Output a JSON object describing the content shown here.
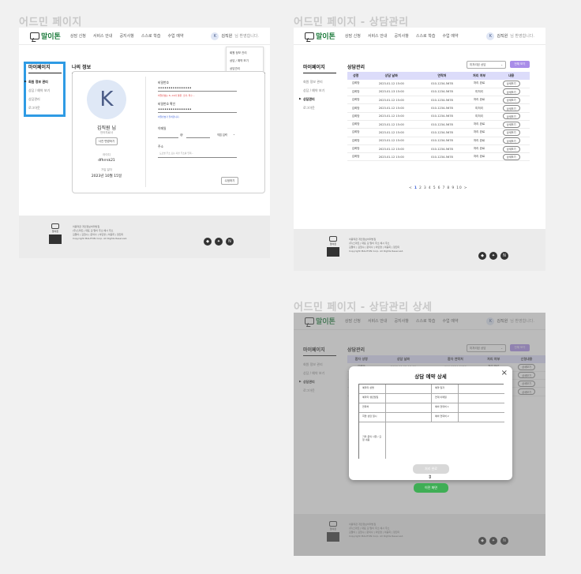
{
  "sections": {
    "s1": "어드민 페이지",
    "s2": "어드민 페이지 - 상담관리",
    "s3": "어드민 페이지 - 상담관리 상세"
  },
  "nav": {
    "brand": "말이톤",
    "menu": [
      "상담 신청",
      "서비스 안내",
      "공지사항",
      "스스로 학습",
      "수업 예약"
    ],
    "user_initial": "K",
    "user_name": "김직원",
    "user_suffix": "님 환영합니다."
  },
  "dropdown": [
    "회원 정보 관리",
    "상담 / 예약 보기",
    "상담관리",
    "로그아웃"
  ],
  "sidebar1": {
    "title": "마이페이지",
    "items": [
      "회원 정보 관리",
      "상담 / 예약 보기",
      "상담관리",
      "로그아웃"
    ]
  },
  "sidebar2": {
    "title": "마이페이지",
    "items": [
      "회원 정보 관리",
      "상담 / 예약 보기",
      "상담관리",
      "로그아웃"
    ]
  },
  "profile": {
    "title": "나의 정보",
    "initial": "K",
    "name": "김직원 님",
    "role": "언어치료사",
    "photo_btn": "사진 변경하기",
    "id_label": "아이디",
    "id_value": "dfhrrsk21",
    "join_label": "가입 일자",
    "join_value": "2023년 10월 15일",
    "pw_label": "비밀번호",
    "pw_value": "••••••••••••••••",
    "pw_hint": "비밀번호는 8~16자 영문, 숫자, 특수...",
    "pw2_label": "비밀번호 확인",
    "pw2_value": "••••••••••••••••",
    "pw2_hint": "비밀번호가 일치합니다.",
    "email_label": "이메일",
    "email_value": "",
    "email_at": "@",
    "email_select": "직접 입력",
    "addr_label": "주소",
    "addr_hint": "도로명 주소 또는 지번 주소를 입력...",
    "save_btn": "수정하기"
  },
  "consult": {
    "title": "상담관리",
    "filter": "미처리된 상담",
    "search_btn": "전체 보기",
    "headers": [
      "성명",
      "상담 날짜",
      "연락처",
      "처리 여부",
      "내용"
    ],
    "rows": [
      {
        "name": "김희망",
        "date": "2023.01.12 15:00",
        "phone": "010-1234-5678",
        "status": "처리 완료",
        "state": "done",
        "action": "상세보기"
      },
      {
        "name": "김희망",
        "date": "2023.01.13 15:00",
        "phone": "010-1234-5678",
        "status": "미처리",
        "state": "wait",
        "action": "상세보기"
      },
      {
        "name": "김희망",
        "date": "2023.01.12 15:00",
        "phone": "010-1234-5678",
        "status": "처리 완료",
        "state": "done",
        "action": "상세보기"
      },
      {
        "name": "김희망",
        "date": "2023.01.12 15:00",
        "phone": "010-1234-5678",
        "status": "미처리",
        "state": "wait",
        "action": "상세보기"
      },
      {
        "name": "김희망",
        "date": "2023.01.12 15:00",
        "phone": "010-1234-5678",
        "status": "미처리",
        "state": "wait",
        "action": "상세보기"
      },
      {
        "name": "김희망",
        "date": "2023.01.12 15:00",
        "phone": "010-1234-5678",
        "status": "처리 완료",
        "state": "done",
        "action": "상세보기"
      },
      {
        "name": "김희망",
        "date": "2023.01.12 15:00",
        "phone": "010-1234-5678",
        "status": "처리 완료",
        "state": "done",
        "action": "상세보기"
      },
      {
        "name": "김희망",
        "date": "2023.01.12 15:00",
        "phone": "010-1234-5678",
        "status": "처리 완료",
        "state": "done",
        "action": "상세보기"
      },
      {
        "name": "김희망",
        "date": "2023.01.12 15:00",
        "phone": "010-1234-5678",
        "status": "처리 완료",
        "state": "done",
        "action": "상세보기"
      },
      {
        "name": "김희망",
        "date": "2023.01.12 15:00",
        "phone": "010-1234-5678",
        "status": "처리 완료",
        "state": "done",
        "action": "상세보기"
      }
    ],
    "pager_prev": "<",
    "pages": [
      "1",
      "2",
      "3",
      "4",
      "5",
      "6",
      "7",
      "8",
      "9",
      "10"
    ],
    "pager_next": ">"
  },
  "consult3": {
    "headers": [
      "환자 성명",
      "상담 날짜",
      "환자 연락처",
      "처리 여부",
      "신청내용"
    ]
  },
  "modal": {
    "title": "상담 예약 상세",
    "close": "×",
    "labels_left": [
      "예약자 성명",
      "예약자 생년월일",
      "연락처",
      "희망 상담 일시"
    ],
    "labels_right": [
      "예약 일자",
      "연계 이메일",
      "예비 연락처 1",
      "예비 연락처 2"
    ],
    "memo_label": "기타 문의 사항 / 요청 내용",
    "process_btn": "처리 완료",
    "back_btn": "이전 화면"
  },
  "footer": {
    "logo": "말이톤",
    "links": "이용약관     개인정보처리방침",
    "line1": "(주)스마트 | 대표 김 말이 주소 예시 주소",
    "line2": "김말이 | 김철수 | 문의사 | 이민영 | 이중희 | 정진미",
    "copy": "Copyright MALITON Corp. All Rights Reserved."
  },
  "colors": {
    "accent_blue": "#2f9be4",
    "purple": "#a98de8",
    "green": "#3fae55",
    "status_done": "#3a5fd6",
    "status_wait": "#e03a3a"
  }
}
